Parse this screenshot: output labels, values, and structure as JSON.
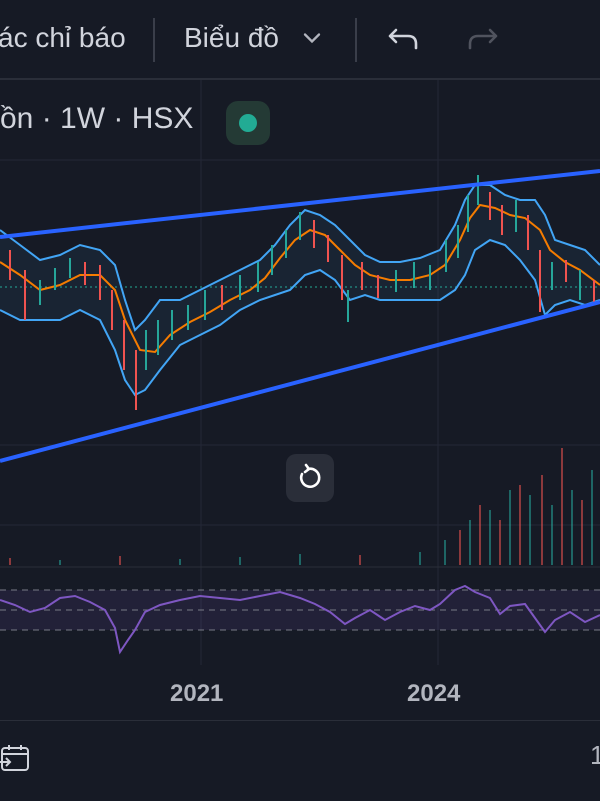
{
  "toolbar": {
    "indicators_label": "ác chỉ báo",
    "chart_type_label": "Biểu đồ",
    "chart_type_chevron": "chevron-down-icon",
    "undo_icon": "undo-icon",
    "redo_icon": "redo-icon"
  },
  "legend": {
    "symbol_text": "ồn · 1W · HSX",
    "status_color": "#22ab94"
  },
  "time_axis": {
    "labels": [
      "2021",
      "2024"
    ]
  },
  "bottom": {
    "calendar_icon": "calendar-goto-icon",
    "edge_text": "1"
  },
  "colors": {
    "background": "#161a25",
    "trendline": "#2962ff",
    "bollinger": "#42a5f5",
    "ma": "#f57c00",
    "rsi": "#7e57c2",
    "up": "#26a69a",
    "down": "#ef5350"
  }
}
